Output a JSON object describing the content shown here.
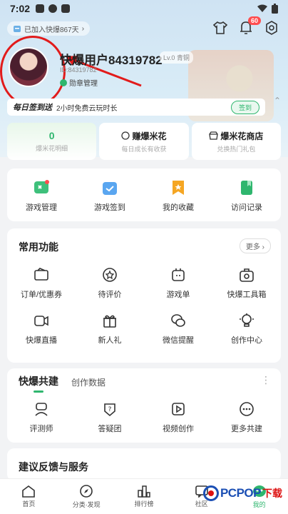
{
  "status_bar": {
    "time": "7:02"
  },
  "header": {
    "joined_text": "已加入快爆867天",
    "message_badge": "60"
  },
  "profile": {
    "username": "快爆用户84319782",
    "level_tag": "Lv.0 青铜",
    "user_id": "ID:84319782",
    "badge_mgmt": "勋章管理"
  },
  "signin": {
    "title": "每日签到送",
    "desc": "2小时免费云玩时长",
    "button": "签到"
  },
  "tri_cards": [
    {
      "main": "0",
      "sub": "爆米花明细"
    },
    {
      "main": "赚爆米花",
      "sub": "每日成长有收获"
    },
    {
      "main": "爆米花商店",
      "sub": "兑换热门礼包"
    }
  ],
  "quick_grid": [
    {
      "label": "游戏管理",
      "icon": "game-manage-icon"
    },
    {
      "label": "游戏签到",
      "icon": "game-signin-icon"
    },
    {
      "label": "我的收藏",
      "icon": "favorites-icon"
    },
    {
      "label": "访问记录",
      "icon": "history-icon"
    }
  ],
  "common": {
    "title": "常用功能",
    "more": "更多",
    "row1": [
      {
        "label": "订单/优惠券",
        "icon": "coupon-icon"
      },
      {
        "label": "待评价",
        "icon": "review-icon"
      },
      {
        "label": "游戏单",
        "icon": "gamelist-icon"
      },
      {
        "label": "快爆工具箱",
        "icon": "toolbox-icon"
      }
    ],
    "row2": [
      {
        "label": "快爆直播",
        "icon": "live-icon"
      },
      {
        "label": "新人礼",
        "icon": "gift-icon"
      },
      {
        "label": "微信提醒",
        "icon": "wechat-icon"
      },
      {
        "label": "创作中心",
        "icon": "creator-icon"
      }
    ]
  },
  "cobuild": {
    "tabs": [
      "快爆共建",
      "创作数据"
    ],
    "items": [
      {
        "label": "评测师",
        "icon": "reviewer-icon"
      },
      {
        "label": "答疑团",
        "icon": "qa-icon"
      },
      {
        "label": "视频创作",
        "icon": "video-icon"
      },
      {
        "label": "更多共建",
        "icon": "more-icon"
      }
    ]
  },
  "feedback": {
    "title": "建议反馈与服务"
  },
  "bottom_nav": [
    {
      "label": "首页"
    },
    {
      "label": "分类·发现"
    },
    {
      "label": "排行榜"
    },
    {
      "label": "社区"
    },
    {
      "label": "我的"
    }
  ],
  "watermark": {
    "brand": "PCPOP",
    "suffix": "下载"
  },
  "colors": {
    "accent": "#2fb66e",
    "annotation": "#e21b1b",
    "badge": "#ff4d4f"
  }
}
